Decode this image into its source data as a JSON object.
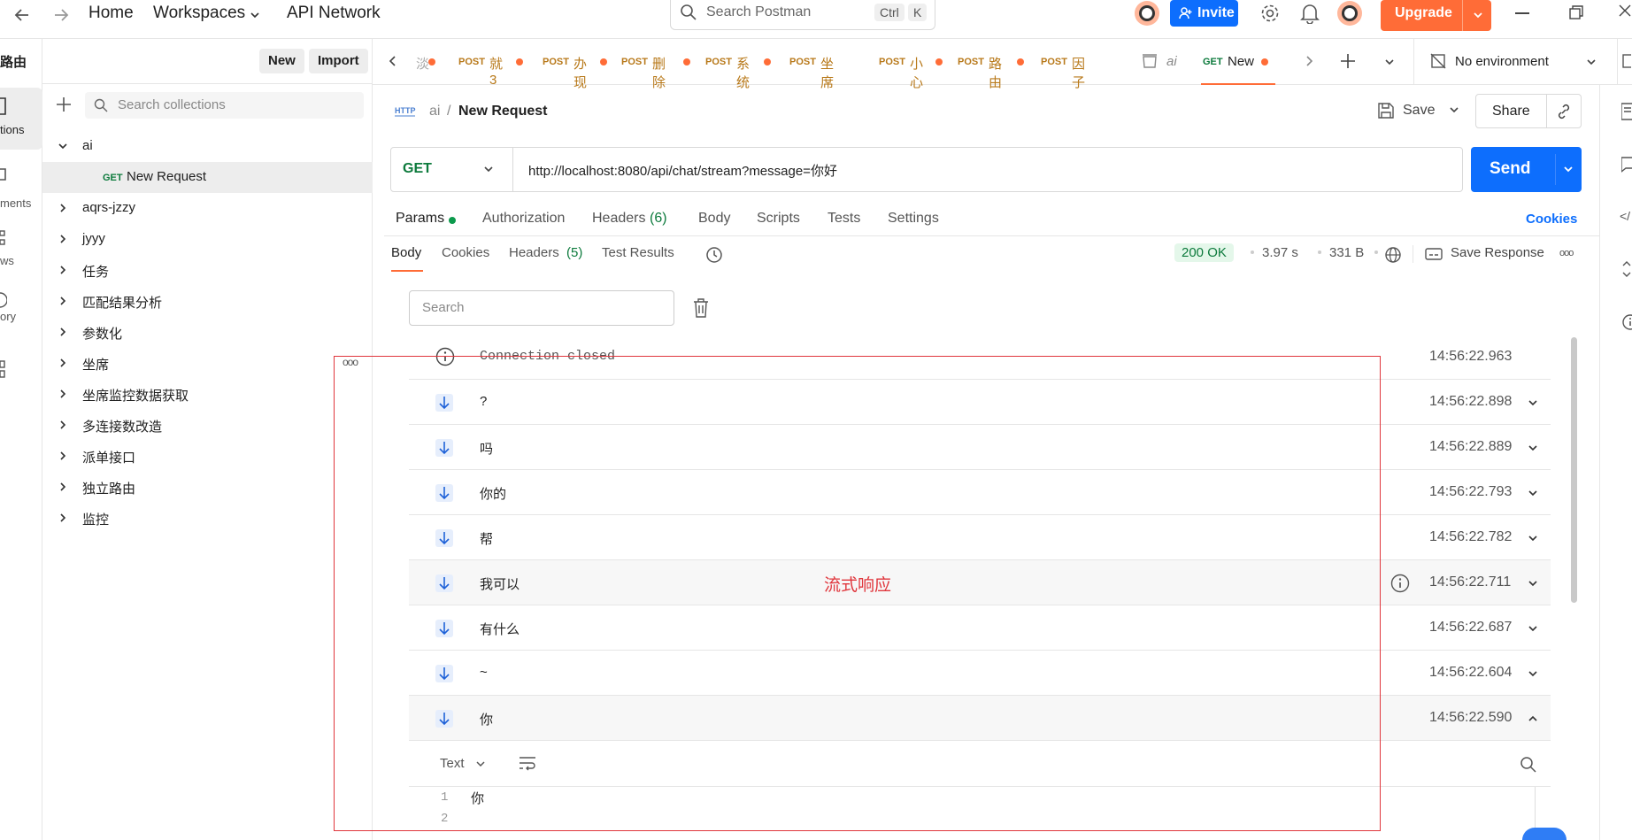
{
  "topbar": {
    "home": "Home",
    "workspaces": "Workspaces",
    "api_network": "API Network",
    "search_placeholder": "Search Postman",
    "kbd_ctrl": "Ctrl",
    "kbd_k": "K",
    "invite": "Invite",
    "upgrade": "Upgrade"
  },
  "rail": {
    "workspace_name": "路由",
    "items": [
      "tions",
      "ments",
      "ws",
      "ory"
    ]
  },
  "sidebar": {
    "new_button": "New",
    "import_button": "Import",
    "search_placeholder": "Search collections",
    "tree": [
      {
        "label": "ai",
        "expanded": true
      },
      {
        "label": "New Request",
        "method": "GET",
        "child": true
      },
      {
        "label": "aqrs-jzzy"
      },
      {
        "label": "jyyy"
      },
      {
        "label": "任务"
      },
      {
        "label": "匹配结果分析"
      },
      {
        "label": "参数化"
      },
      {
        "label": "坐席"
      },
      {
        "label": "坐席监控数据获取"
      },
      {
        "label": "多连接数改造"
      },
      {
        "label": "派单接口"
      },
      {
        "label": "独立路由"
      },
      {
        "label": "监控"
      }
    ]
  },
  "tabs": [
    {
      "method": "",
      "label": "淡",
      "dot": true
    },
    {
      "method": "POST",
      "label": "就3",
      "dot": true
    },
    {
      "method": "POST",
      "label": "办现",
      "dot": true
    },
    {
      "method": "POST",
      "label": "删除",
      "dot": true
    },
    {
      "method": "POST",
      "label": "系统",
      "dot": true
    },
    {
      "method": "POST",
      "label": "坐席",
      "dot": false
    },
    {
      "method": "POST",
      "label": "小心",
      "dot": true
    },
    {
      "method": "POST",
      "label": "路由",
      "dot": true
    },
    {
      "method": "POST",
      "label": "因子",
      "dot": false
    },
    {
      "method": "",
      "label": "ai",
      "dot": false
    },
    {
      "method": "GET",
      "label": "New",
      "dot": true
    }
  ],
  "environment": "No environment",
  "request": {
    "breadcrumb_parent": "ai",
    "breadcrumb_sep": "/",
    "title": "New Request",
    "save": "Save",
    "share": "Share",
    "method": "GET",
    "url": "http://localhost:8080/api/chat/stream?message=你好",
    "send": "Send",
    "tabs": [
      "Params",
      "Authorization",
      "Headers",
      "(6)",
      "Body",
      "Scripts",
      "Tests",
      "Settings"
    ],
    "cookies": "Cookies"
  },
  "response": {
    "tabs": [
      "Body",
      "Cookies",
      "Headers",
      "(5)",
      "Test Results"
    ],
    "status": "200 OK",
    "time": "3.97 s",
    "size": "331 B",
    "save_response": "Save Response",
    "search_placeholder": "Search"
  },
  "messages": [
    {
      "text": "Connection closed",
      "time": "14:56:22.963",
      "kind": "info"
    },
    {
      "text": "?",
      "time": "14:56:22.898",
      "kind": "down"
    },
    {
      "text": "吗",
      "time": "14:56:22.889",
      "kind": "down"
    },
    {
      "text": "你的",
      "time": "14:56:22.793",
      "kind": "down"
    },
    {
      "text": "帮",
      "time": "14:56:22.782",
      "kind": "down"
    },
    {
      "text": "我可以",
      "time": "14:56:22.711",
      "kind": "down"
    },
    {
      "text": "有什么",
      "time": "14:56:22.687",
      "kind": "down"
    },
    {
      "text": "~",
      "time": "14:56:22.604",
      "kind": "down"
    },
    {
      "text": "你",
      "time": "14:56:22.590",
      "kind": "down"
    }
  ],
  "annotation": "流式响应",
  "detail": {
    "format": "Text",
    "lines": [
      {
        "n": "1",
        "t": "你"
      },
      {
        "n": "2",
        "t": ""
      }
    ]
  },
  "colors": {
    "accent": "#0d6efd",
    "brand": "#ff6c37",
    "annotation": "#e0363c"
  }
}
